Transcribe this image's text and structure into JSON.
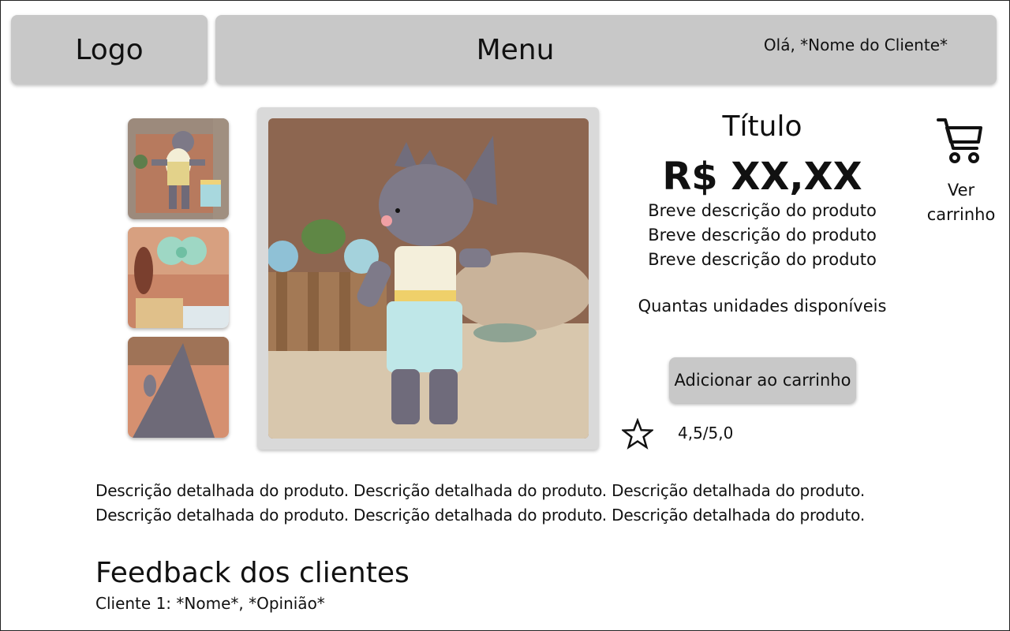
{
  "header": {
    "logo_label": "Logo",
    "menu_label": "Menu",
    "greeting": "Olá, *Nome do Cliente*"
  },
  "gallery": {
    "thumbnails": [
      {
        "name": "thumbnail-1",
        "icon": "rhino-toy-flatlay"
      },
      {
        "name": "thumbnail-2",
        "icon": "crochet-bow-detail"
      },
      {
        "name": "thumbnail-3",
        "icon": "rhino-horn-detail"
      }
    ],
    "main_image": "crochet-rhino-toy"
  },
  "product": {
    "title": "Título",
    "price": "R$ XX,XX",
    "short_description": [
      "Breve descrição do produto",
      "Breve descrição do produto",
      "Breve descrição do produto"
    ],
    "stock": "Quantas unidades disponíveis",
    "add_to_cart": "Adicionar ao carrinho",
    "rating": "4,5/5,0"
  },
  "cart": {
    "icon": "shopping-cart-icon",
    "label_line1": "Ver",
    "label_line2": "carrinho"
  },
  "details": {
    "lines": [
      "Descrição detalhada do produto. Descrição detalhada do produto. Descrição detalhada do produto.",
      "Descrição detalhada do produto. Descrição detalhada do produto. Descrição detalhada do produto."
    ]
  },
  "feedback": {
    "title": "Feedback dos clientes",
    "items": [
      "Cliente 1: *Nome*, *Opinião*"
    ]
  },
  "colors": {
    "bar": "#c8c8c8",
    "border": "#222222",
    "text": "#111111"
  }
}
